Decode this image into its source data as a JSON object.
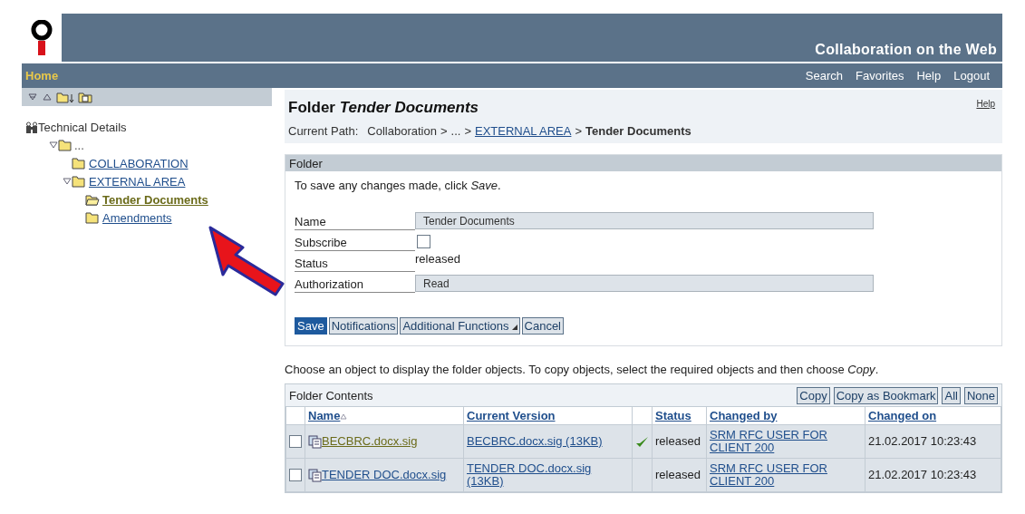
{
  "header": {
    "title": "Collaboration on the Web"
  },
  "nav": {
    "home": "Home",
    "links": [
      "Search",
      "Favorites",
      "Help",
      "Logout"
    ]
  },
  "sidebar": {
    "technical_details": "Technical Details",
    "tree": [
      {
        "label": "...",
        "expanded": true,
        "selected": false,
        "children": [
          {
            "label": "COLLABORATION",
            "selected": false
          },
          {
            "label": "EXTERNAL AREA",
            "expanded": true,
            "selected": false,
            "children": [
              {
                "label": "Tender Documents",
                "selected": true
              },
              {
                "label": "Amendments",
                "selected": false
              }
            ]
          }
        ]
      }
    ]
  },
  "main": {
    "title": "Folder *Tender Documents*",
    "help": "Help",
    "path_label": "Current Path:",
    "path": [
      {
        "kind": "text",
        "text": "Collaboration"
      },
      {
        "kind": "sep",
        "text": ">"
      },
      {
        "kind": "text",
        "text": "..."
      },
      {
        "kind": "sep",
        "text": ">"
      },
      {
        "kind": "link",
        "text": "EXTERNAL AREA"
      },
      {
        "kind": "sep",
        "text": ">"
      },
      {
        "kind": "current",
        "text": "Tender Documents"
      }
    ],
    "folder": {
      "header": "Folder",
      "message": "To save any changes made, click *Save*.",
      "fields": [
        {
          "kind": "input",
          "label": "Name",
          "value": "Tender Documents"
        },
        {
          "kind": "checkbox",
          "label": "Subscribe",
          "checked": false
        },
        {
          "kind": "text",
          "label": "Status",
          "value": "released"
        },
        {
          "kind": "input",
          "label": "Authorization",
          "value": "Read"
        }
      ],
      "buttons": [
        {
          "kind": "primary",
          "label": "Save"
        },
        {
          "kind": "normal",
          "label": "Notifications"
        },
        {
          "kind": "menu",
          "label": "Additional Functions"
        },
        {
          "kind": "normal",
          "label": "Cancel"
        }
      ]
    },
    "instructions": "Choose an object to display the folder objects. To copy objects, select the required objects and then choose *Copy*.",
    "table": {
      "title": "Folder Contents",
      "actions": [
        "Copy",
        "Copy as Bookmark",
        "All",
        "None"
      ],
      "columns": [
        {
          "label": "Name",
          "sorted": true
        },
        {
          "label": "Current Version",
          "sorted": false
        },
        {
          "label": "Status",
          "sorted": false
        },
        {
          "label": "Changed by",
          "sorted": false
        },
        {
          "label": "Changed on",
          "sorted": false
        }
      ],
      "rows": [
        {
          "checked": false,
          "name": "BECBRC.docx.sig",
          "visited": true,
          "version": "BECBRC.docx.sig (13KB)",
          "approved": true,
          "status": "released",
          "changed_by": "SRM RFC USER FOR CLIENT 200",
          "changed_on": "21.02.2017 10:23:43"
        },
        {
          "checked": false,
          "name": "TENDER DOC.docx.sig",
          "visited": false,
          "version": "TENDER DOC.docx.sig (13KB)",
          "approved": false,
          "status": "released",
          "changed_by": "SRM RFC USER FOR CLIENT 200",
          "changed_on": "21.02.2017 10:23:43"
        }
      ]
    }
  }
}
